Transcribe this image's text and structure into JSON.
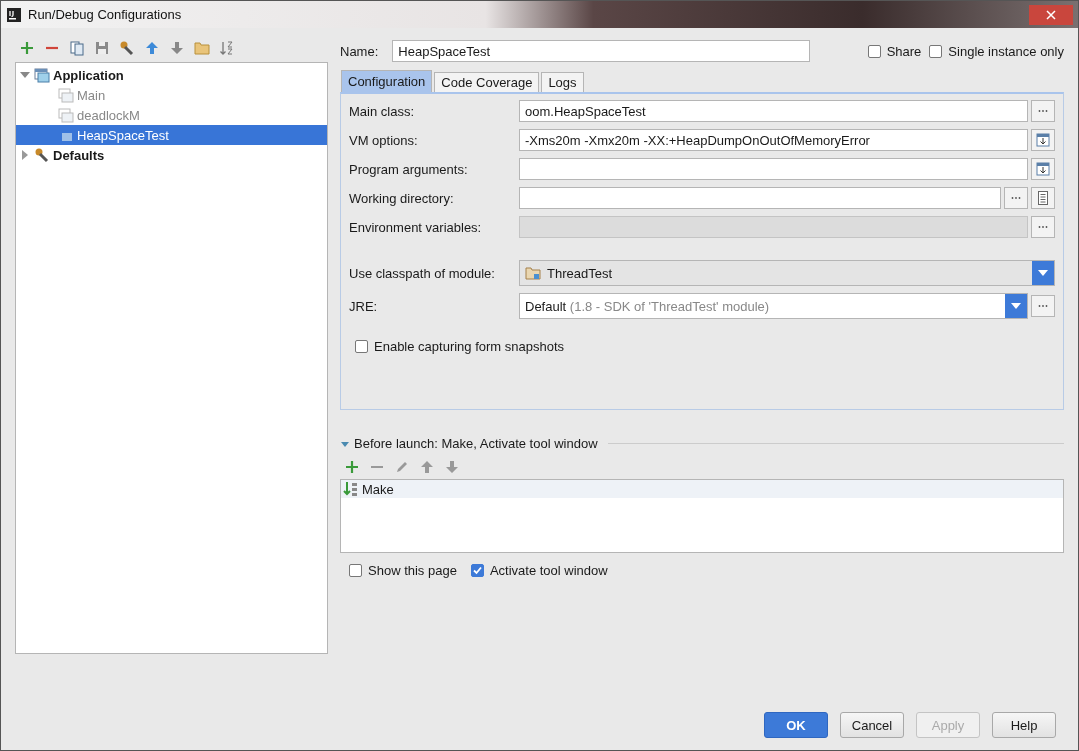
{
  "window": {
    "title": "Run/Debug Configurations"
  },
  "tree": [
    {
      "label": "Application",
      "kind": "application",
      "expanded": true,
      "selected": false,
      "children": [
        {
          "label": "Main",
          "kind": "config",
          "temporary": true,
          "selected": false
        },
        {
          "label": "deadlockM",
          "kind": "config",
          "temporary": true,
          "selected": false
        },
        {
          "label": "HeapSpaceTest",
          "kind": "config",
          "temporary": false,
          "selected": true
        }
      ]
    },
    {
      "label": "Defaults",
      "kind": "defaults",
      "expanded": false,
      "selected": false
    }
  ],
  "name": {
    "label": "Name:",
    "value": "HeapSpaceTest"
  },
  "options": [
    {
      "label": "Share",
      "checked": false
    },
    {
      "label": "Single instance only",
      "checked": false
    }
  ],
  "tabs": [
    {
      "label": "Configuration",
      "selected": true
    },
    {
      "label": "Code Coverage",
      "selected": false
    },
    {
      "label": "Logs",
      "selected": false
    }
  ],
  "fields": [
    {
      "label": "Main class:",
      "value": "oom.HeapSpaceTest",
      "kind": "text",
      "disabled": false,
      "buttons": [
        {
          "kind": "browse"
        }
      ]
    },
    {
      "label": "VM options:",
      "value": "-Xms20m -Xmx20m -XX:+HeapDumpOnOutOfMemoryError",
      "kind": "text",
      "disabled": false,
      "buttons": [
        {
          "kind": "expand"
        }
      ]
    },
    {
      "label": "Program arguments:",
      "kind": "text",
      "disabled": false,
      "buttons": [
        {
          "kind": "expand"
        }
      ]
    },
    {
      "label": "Working directory:",
      "kind": "text",
      "disabled": false,
      "buttons": [
        {
          "kind": "browse"
        },
        {
          "kind": "macro"
        }
      ]
    },
    {
      "label": "Environment variables:",
      "kind": "text",
      "disabled": true,
      "buttons": [
        {
          "kind": "browse"
        }
      ]
    },
    {
      "label": "Use classpath of module:",
      "value": "ThreadTest",
      "kind": "module",
      "disabled": false
    },
    {
      "label": "JRE:",
      "value": "Default",
      "hint": "(1.8 - SDK of 'ThreadTest' module)",
      "kind": "combo",
      "disabled": false,
      "buttons": [
        {
          "kind": "browse"
        }
      ]
    }
  ],
  "capture": {
    "label": "Enable capturing form snapshots",
    "checked": false
  },
  "before_launch": {
    "title": "Before launch: Make, Activate tool window",
    "expanded": true,
    "tasks": [
      {
        "label": "Make",
        "selected": true
      }
    ],
    "options": [
      {
        "label": "Show this page",
        "checked": false
      },
      {
        "label": "Activate tool window",
        "checked": true
      }
    ]
  },
  "buttons": [
    {
      "label": "OK",
      "kind": "default",
      "disabled": false
    },
    {
      "label": "Cancel",
      "kind": "normal",
      "disabled": false
    },
    {
      "label": "Apply",
      "kind": "normal",
      "disabled": true
    },
    {
      "label": "Help",
      "kind": "normal",
      "disabled": false
    }
  ]
}
